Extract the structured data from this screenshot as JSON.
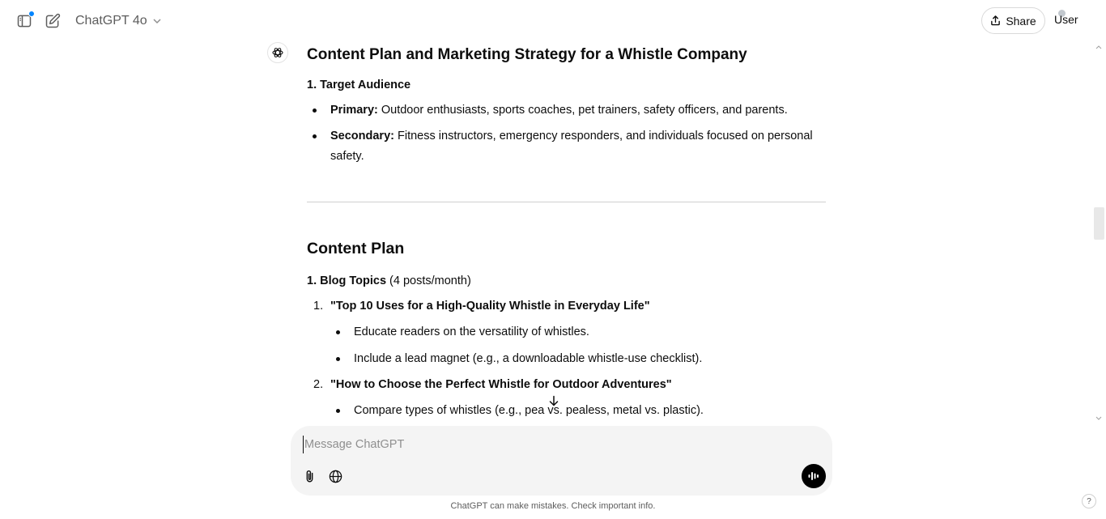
{
  "header": {
    "model_name": "ChatGPT 4o",
    "share_label": "Share",
    "user_label": "User",
    "icons": [
      "sidebar-icon",
      "new-chat-icon",
      "chevron-down-icon",
      "share-icon"
    ]
  },
  "message": {
    "title": "Content Plan and Marketing Strategy for a Whistle Company",
    "section1_heading": "1. Target Audience",
    "bullets": [
      {
        "label": "Primary:",
        "text": " Outdoor enthusiasts, sports coaches, pet trainers, safety officers, and parents."
      },
      {
        "label": "Secondary:",
        "text": " Fitness instructors, emergency responders, and individuals focused on personal safety."
      }
    ],
    "content_plan_heading": "Content Plan",
    "blog_heading": "1. Blog Topics",
    "blog_frequency": " (4 posts/month)",
    "posts": [
      {
        "number": "1.",
        "title": "\"Top 10 Uses for a High-Quality Whistle in Everyday Life\"",
        "points": [
          "Educate readers on the versatility of whistles.",
          "Include a lead magnet (e.g., a downloadable whistle-use checklist)."
        ]
      },
      {
        "number": "2.",
        "title": "\"How to Choose the Perfect Whistle for Outdoor Adventures\"",
        "points": [
          "Compare types of whistles (e.g., pea vs. pealess, metal vs. plastic)."
        ]
      }
    ]
  },
  "composer": {
    "placeholder": "Message ChatGPT",
    "value": ""
  },
  "footer": {
    "disclaimer": "ChatGPT can make mistakes. Check important info.",
    "help_label": "?"
  },
  "colors": {
    "accent_dot": "#0285ff",
    "composer_bg": "#f4f4f4",
    "text": "#0d0d0d"
  }
}
